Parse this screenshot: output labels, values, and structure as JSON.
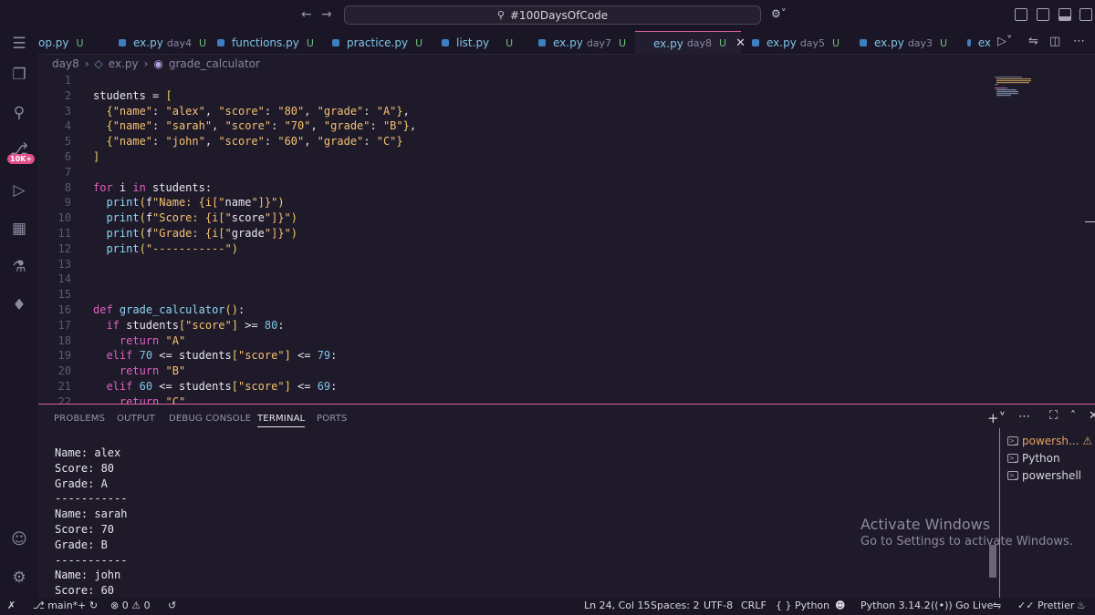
{
  "titlebar": {
    "search_text": "#100DaysOfCode"
  },
  "tabs": [
    {
      "label": "op.py",
      "dir": "",
      "status": "U"
    },
    {
      "label": "ex.py",
      "dir": "day4",
      "status": "U"
    },
    {
      "label": "functions.py",
      "dir": "",
      "status": "U"
    },
    {
      "label": "practice.py",
      "dir": "",
      "status": "U"
    },
    {
      "label": "list.py",
      "dir": "",
      "status": "U"
    },
    {
      "label": "ex.py",
      "dir": "day7",
      "status": "U"
    },
    {
      "label": "ex.py",
      "dir": "day8",
      "status": "U",
      "active": true
    },
    {
      "label": "ex.py",
      "dir": "day5",
      "status": "U"
    },
    {
      "label": "ex.py",
      "dir": "day3",
      "status": "U"
    },
    {
      "label": "ex",
      "dir": "",
      "status": ""
    }
  ],
  "activity": {
    "badge": "10K+"
  },
  "breadcrumb": {
    "folder": "day8",
    "file": "ex.py",
    "symbol": "grade_calculator"
  },
  "editor": {
    "line_numbers": [
      "1",
      "2",
      "3",
      "4",
      "5",
      "6",
      "7",
      "8",
      "9",
      "10",
      "11",
      "12",
      "13",
      "14",
      "15",
      "16",
      "17",
      "18",
      "19",
      "20",
      "21",
      "22"
    ],
    "lines": [
      "",
      "students = [",
      "  {\"name\": \"alex\", \"score\": \"80\", \"grade\": \"A\"},",
      "  {\"name\": \"sarah\", \"score\": \"70\", \"grade\": \"B\"},",
      "  {\"name\": \"john\", \"score\": \"60\", \"grade\": \"C\"}",
      "]",
      "",
      "for i in students:",
      "  print(f\"Name: {i[\"name\"]}\")",
      "  print(f\"Score: {i[\"score\"]}\")",
      "  print(f\"Grade: {i[\"grade\"]}\")",
      "  print(\"-----------\")",
      "",
      "",
      "",
      "def grade_calculator():",
      "  if students[\"score\"] >= 80:",
      "    return \"A\"",
      "  elif 70 <= students[\"score\"] <= 79:",
      "    return \"B\"",
      "  elif 60 <= students[\"score\"] <= 69:",
      "    return \"C\""
    ]
  },
  "panel": {
    "tabs": [
      "PROBLEMS",
      "OUTPUT",
      "DEBUG CONSOLE",
      "TERMINAL",
      "PORTS"
    ],
    "active_tab": "TERMINAL",
    "terminal_lines": [
      "Name: alex",
      "Score: 80",
      "Grade: A",
      "-----------",
      "Name: sarah",
      "Score: 70",
      "Grade: B",
      "-----------",
      "Name: john",
      "Score: 60"
    ],
    "terminals": [
      {
        "label": "powersh...",
        "warn": true
      },
      {
        "label": "Python",
        "warn": false
      },
      {
        "label": "powershell",
        "warn": false
      }
    ]
  },
  "watermark": {
    "title": "Activate Windows",
    "subtitle": "Go to Settings to activate Windows."
  },
  "statusbar": {
    "branch": "main*+",
    "errors": "0",
    "warnings": "0",
    "position": "Ln 24, Col 15",
    "spaces": "Spaces: 2",
    "encoding": "UTF-8",
    "eol": "CRLF",
    "language": "Python",
    "interpreter": "Python 3.14.2",
    "golive": "Go Live",
    "prettier": "Prettier"
  },
  "colors": {
    "accent": "#e060a0",
    "keyword": "#e060c0",
    "string": "#f5c070",
    "number": "#7ec4e6",
    "tab_text": "#7ec4e6",
    "untracked": "#6fc27a"
  }
}
